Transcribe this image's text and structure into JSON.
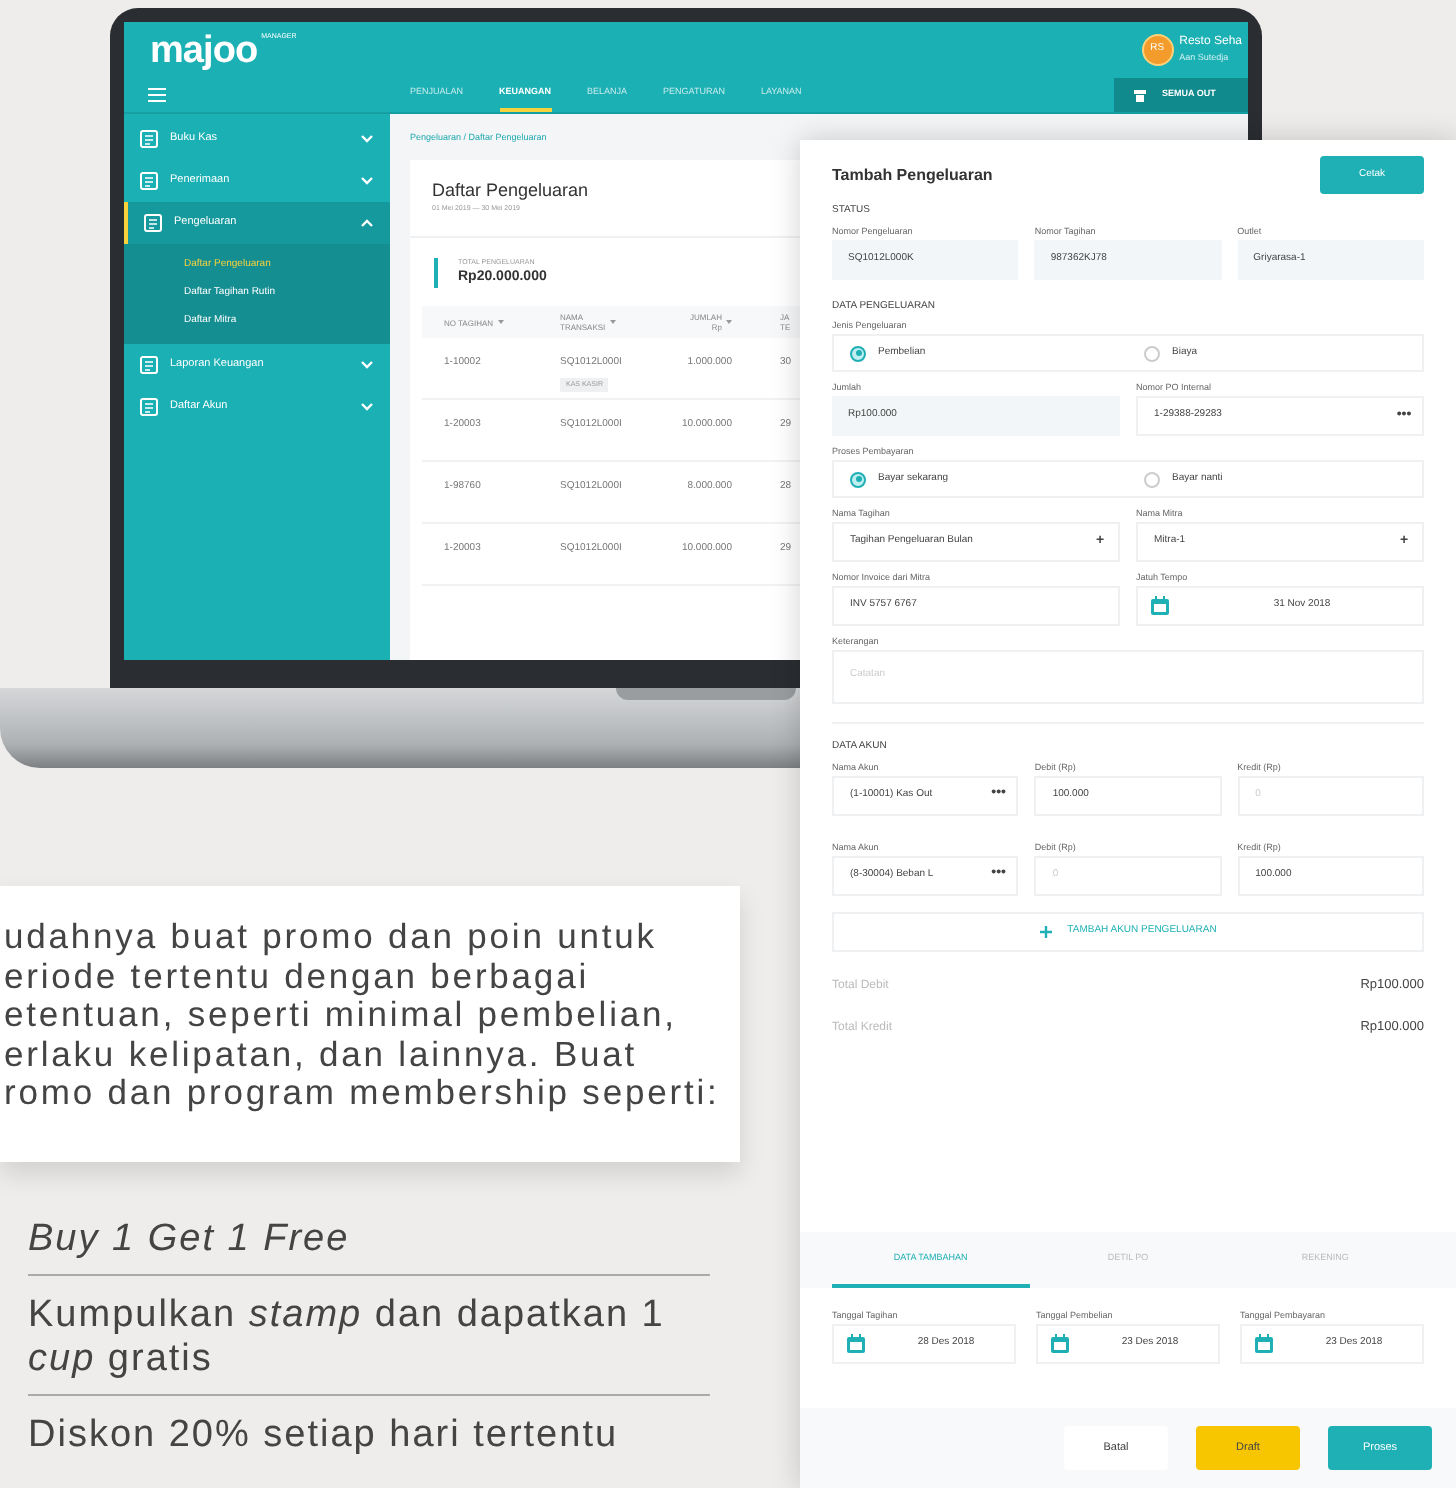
{
  "app": {
    "logo": "majoo",
    "logo_badge": "MANAGER",
    "user": {
      "initials": "RS",
      "name": "Resto Seha",
      "subtitle": "Aan Sutedja"
    },
    "nav_tabs": [
      {
        "label": "PENJUALAN",
        "selected": false
      },
      {
        "label": "KEUANGAN",
        "selected": true
      },
      {
        "label": "BELANJA",
        "selected": false
      },
      {
        "label": "PENGATURAN",
        "selected": false
      },
      {
        "label": "LAYANAN",
        "selected": false
      }
    ],
    "outlet_button": "SEMUA OUT"
  },
  "sidebar": {
    "items": [
      {
        "label": "Buku Kas",
        "expanded": false
      },
      {
        "label": "Penerimaan",
        "expanded": false
      },
      {
        "label": "Pengeluaran",
        "expanded": true,
        "children": [
          {
            "label": "Daftar Pengeluaran",
            "selected": true
          },
          {
            "label": "Daftar Tagihan Rutin",
            "selected": false
          },
          {
            "label": "Daftar Mitra",
            "selected": false
          }
        ]
      },
      {
        "label": "Laporan Keuangan",
        "expanded": false
      },
      {
        "label": "Daftar Akun",
        "expanded": false
      }
    ]
  },
  "breadcrumb": "Pengeluaran / Daftar Pengeluaran",
  "list_card": {
    "title": "Daftar Pengeluaran",
    "date_range": "01 Mei 2019 — 30 Mei 2019",
    "total_label": "TOTAL PENGELUARAN",
    "total_value": "Rp20.000.000",
    "table": {
      "columns": [
        {
          "lines": [
            "NO TAGIHAN"
          ],
          "sortable": true
        },
        {
          "lines": [
            "NAMA",
            "TRANSAKSI"
          ],
          "sortable": true
        },
        {
          "lines": [
            "JUMLAH",
            "Rp"
          ],
          "sortable": true
        },
        {
          "lines": [
            "JA",
            "TE"
          ],
          "sortable": false
        }
      ],
      "rows": [
        {
          "cells": [
            "1-10002",
            "SQ1012L000I",
            "1.000.000",
            "30"
          ],
          "tag": "KAS KASIR"
        },
        {
          "cells": [
            "1-20003",
            "SQ1012L000I",
            "10.000.000",
            "29"
          ]
        },
        {
          "cells": [
            "1-98760",
            "SQ1012L000I",
            "8.000.000",
            "28"
          ]
        },
        {
          "cells": [
            "1-20003",
            "SQ1012L000I",
            "10.000.000",
            "29"
          ]
        }
      ]
    }
  },
  "form": {
    "title": "Tambah Pengeluaran",
    "print_button": "Cetak",
    "sections": [
      {
        "heading": "STATUS",
        "rows": [
          [
            {
              "kind": "input",
              "label": "Nomor Pengeluaran",
              "value": "SQ1012L000K",
              "readonly": true
            },
            {
              "kind": "input",
              "label": "Nomor Tagihan",
              "value": "987362KJ78",
              "readonly": true
            },
            {
              "kind": "input",
              "label": "Outlet",
              "value": "Griyarasa-1",
              "readonly": true
            }
          ]
        ]
      },
      {
        "heading": "DATA PENGELUARAN",
        "rows": [
          [
            {
              "kind": "radio_group",
              "label": "Jenis Pengeluaran",
              "options": [
                {
                  "label": "Pembelian",
                  "selected": true
                },
                {
                  "label": "Biaya",
                  "selected": false
                }
              ]
            }
          ],
          [
            {
              "kind": "input",
              "label": "Jumlah",
              "value": "Rp100.000",
              "readonly": true
            },
            {
              "kind": "input",
              "label": "Nomor PO Internal",
              "value": "1-29388-29283",
              "button": "•••",
              "readonly": false
            }
          ],
          [
            {
              "kind": "radio_group",
              "label": "Proses Pembayaran",
              "options": [
                {
                  "label": "Bayar sekarang",
                  "selected": true
                },
                {
                  "label": "Bayar nanti",
                  "selected": false
                }
              ]
            }
          ],
          [
            {
              "kind": "input",
              "label": "Nama Tagihan",
              "value": "Tagihan Pengeluaran Bulan",
              "button": "+",
              "readonly": false
            },
            {
              "kind": "input",
              "label": "Nama Mitra",
              "value": "Mitra-1",
              "button": "+",
              "readonly": false
            }
          ],
          [
            {
              "kind": "input",
              "label": "Nomor Invoice dari Mitra",
              "value": "INV 5757 6767",
              "readonly": false
            },
            {
              "kind": "date",
              "label": "Jatuh Tempo",
              "value": "31 Nov 2018"
            }
          ],
          [
            {
              "kind": "textarea",
              "label": "Keterangan",
              "placeholder": "Catatan"
            }
          ]
        ]
      },
      {
        "heading": "DATA AKUN",
        "rows": [
          [
            {
              "kind": "input",
              "label": "Nama Akun",
              "value": "(1-10001) Kas Out",
              "button": "•••",
              "readonly": false
            },
            {
              "kind": "input",
              "label": "Debit (Rp)",
              "value": "100.000",
              "readonly": false
            },
            {
              "kind": "input",
              "label": "Kredit (Rp)",
              "placeholder": "0",
              "readonly": false
            }
          ],
          [
            {
              "kind": "input",
              "label": "Nama Akun",
              "value": "(8-30004) Beban L",
              "button": "•••",
              "readonly": false
            },
            {
              "kind": "input",
              "label": "Debit (Rp)",
              "placeholder": "0",
              "readonly": false
            },
            {
              "kind": "input",
              "label": "Kredit (Rp)",
              "value": "100.000",
              "readonly": false
            }
          ]
        ]
      }
    ],
    "add_account_button": "TAMBAH AKUN PENGELUARAN",
    "totals": [
      {
        "label": "Total Debit",
        "value": "Rp100.000"
      },
      {
        "label": "Total Kredit",
        "value": "Rp100.000"
      }
    ],
    "tabs": [
      {
        "label": "DATA TAMBAHAN",
        "selected": true
      },
      {
        "label": "DETIL PO",
        "selected": false
      },
      {
        "label": "REKENING",
        "selected": false
      }
    ],
    "tab_fields": [
      {
        "kind": "date",
        "label": "Tanggal Tagihan",
        "value": "28 Des 2018"
      },
      {
        "kind": "date",
        "label": "Tanggal Pembelian",
        "value": "23 Des 2018"
      },
      {
        "kind": "date",
        "label": "Tanggal Pembayaran",
        "value": "23 Des 2018"
      }
    ],
    "footer_buttons": [
      {
        "label": "Batal",
        "kind": "secondary"
      },
      {
        "label": "Draft",
        "kind": "warning"
      },
      {
        "label": "Proses",
        "kind": "primary"
      }
    ]
  },
  "promo": {
    "description_lines": [
      "udahnya buat promo dan poin untuk",
      "eriode tertentu dengan berbagai",
      "etentuan, seperti minimal pembelian,",
      "erlaku kelipatan, dan lainnya. Buat",
      "romo dan program membership seperti:"
    ],
    "list": [
      {
        "text": "Buy 1 Get 1 Free",
        "italic": true
      },
      {
        "text": "Kumpulkan *stamp* dan dapatkan 1 *cup* gratis",
        "italic": false
      },
      {
        "text": "Diskon 20% setiap hari tertentu",
        "italic": false
      }
    ]
  }
}
